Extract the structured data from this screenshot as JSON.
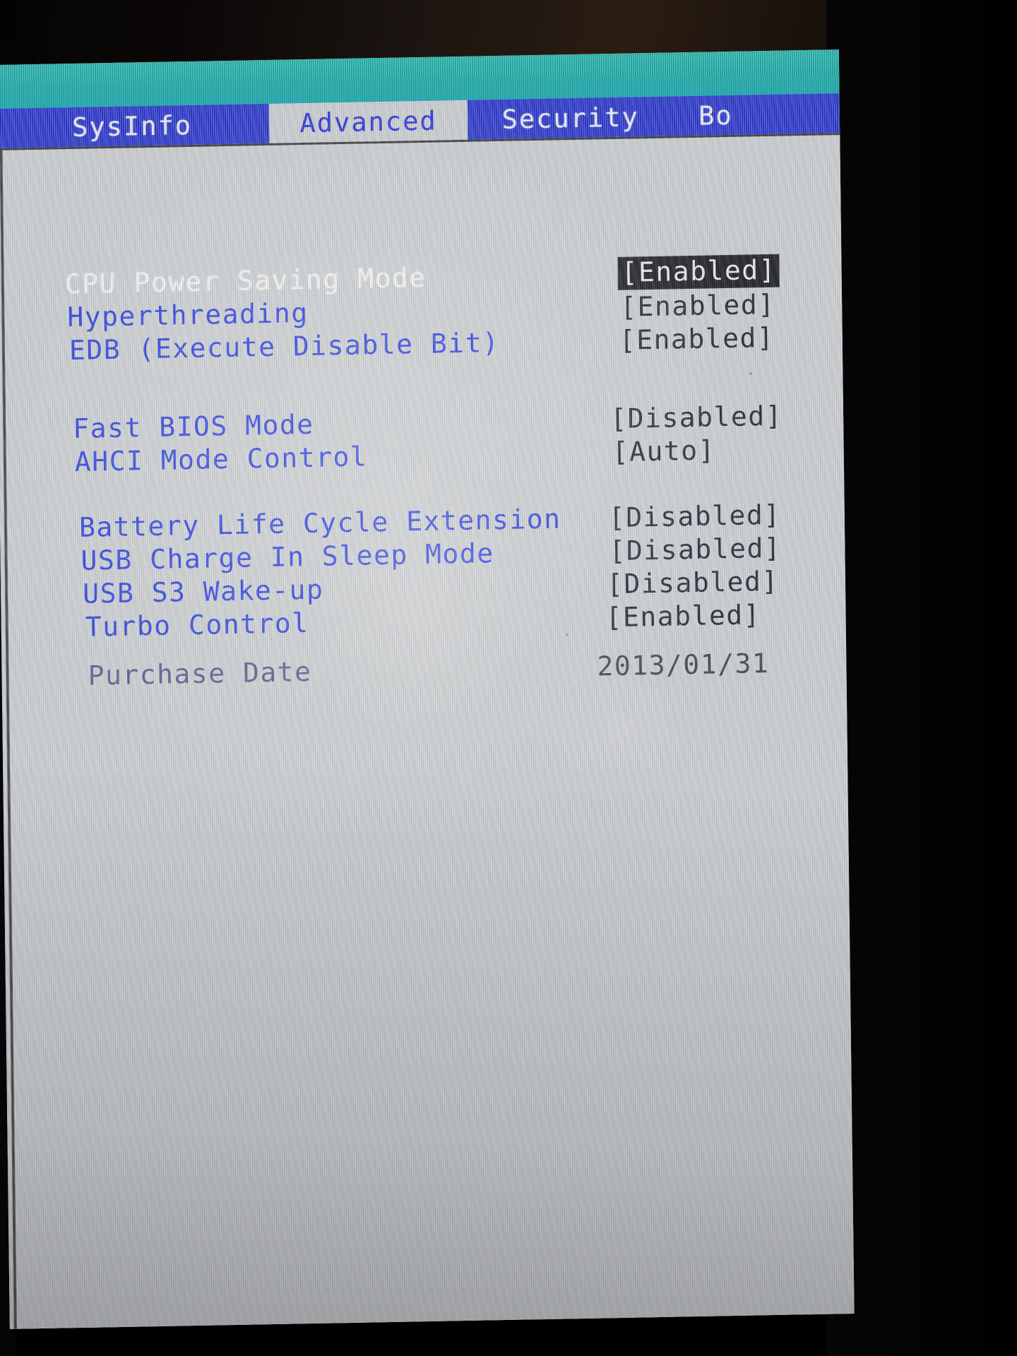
{
  "screen": {
    "kind": "bios-setup-utility",
    "accent_tab_bar": "#1d2ad6",
    "accent_header_band": "#1ea9a6",
    "panel_bg": "#c9ccce",
    "label_color": "#1f35e0",
    "value_color": "#16192b"
  },
  "tabs": [
    {
      "label": "SysInfo",
      "selected": false
    },
    {
      "label": "Advanced",
      "selected": true
    },
    {
      "label": "Security",
      "selected": false
    },
    {
      "label": "Bo",
      "selected": false,
      "truncated": true
    }
  ],
  "groups": [
    {
      "rows": [
        {
          "label": "CPU Power Saving Mode",
          "value": "[Enabled]",
          "selected": true
        },
        {
          "label": "Hyperthreading",
          "value": "[Enabled]",
          "selected": false
        },
        {
          "label": "EDB (Execute Disable Bit)",
          "value": "[Enabled]",
          "selected": false
        }
      ]
    },
    {
      "rows": [
        {
          "label": "Fast BIOS Mode",
          "value": "[Disabled]",
          "selected": false
        },
        {
          "label": "AHCI Mode Control",
          "value": "[Auto]",
          "selected": false
        }
      ]
    },
    {
      "rows": [
        {
          "label": "Battery Life Cycle Extension",
          "value": "[Disabled]",
          "selected": false
        },
        {
          "label": "USB Charge In Sleep Mode",
          "value": "[Disabled]",
          "selected": false
        },
        {
          "label": "USB S3 Wake-up",
          "value": "[Disabled]",
          "selected": false
        },
        {
          "label": "Turbo Control",
          "value": "[Enabled]",
          "selected": false
        }
      ]
    },
    {
      "rows": [
        {
          "label": "Purchase Date",
          "value": "2013/01/31",
          "selected": false,
          "readonly": true
        }
      ]
    }
  ]
}
